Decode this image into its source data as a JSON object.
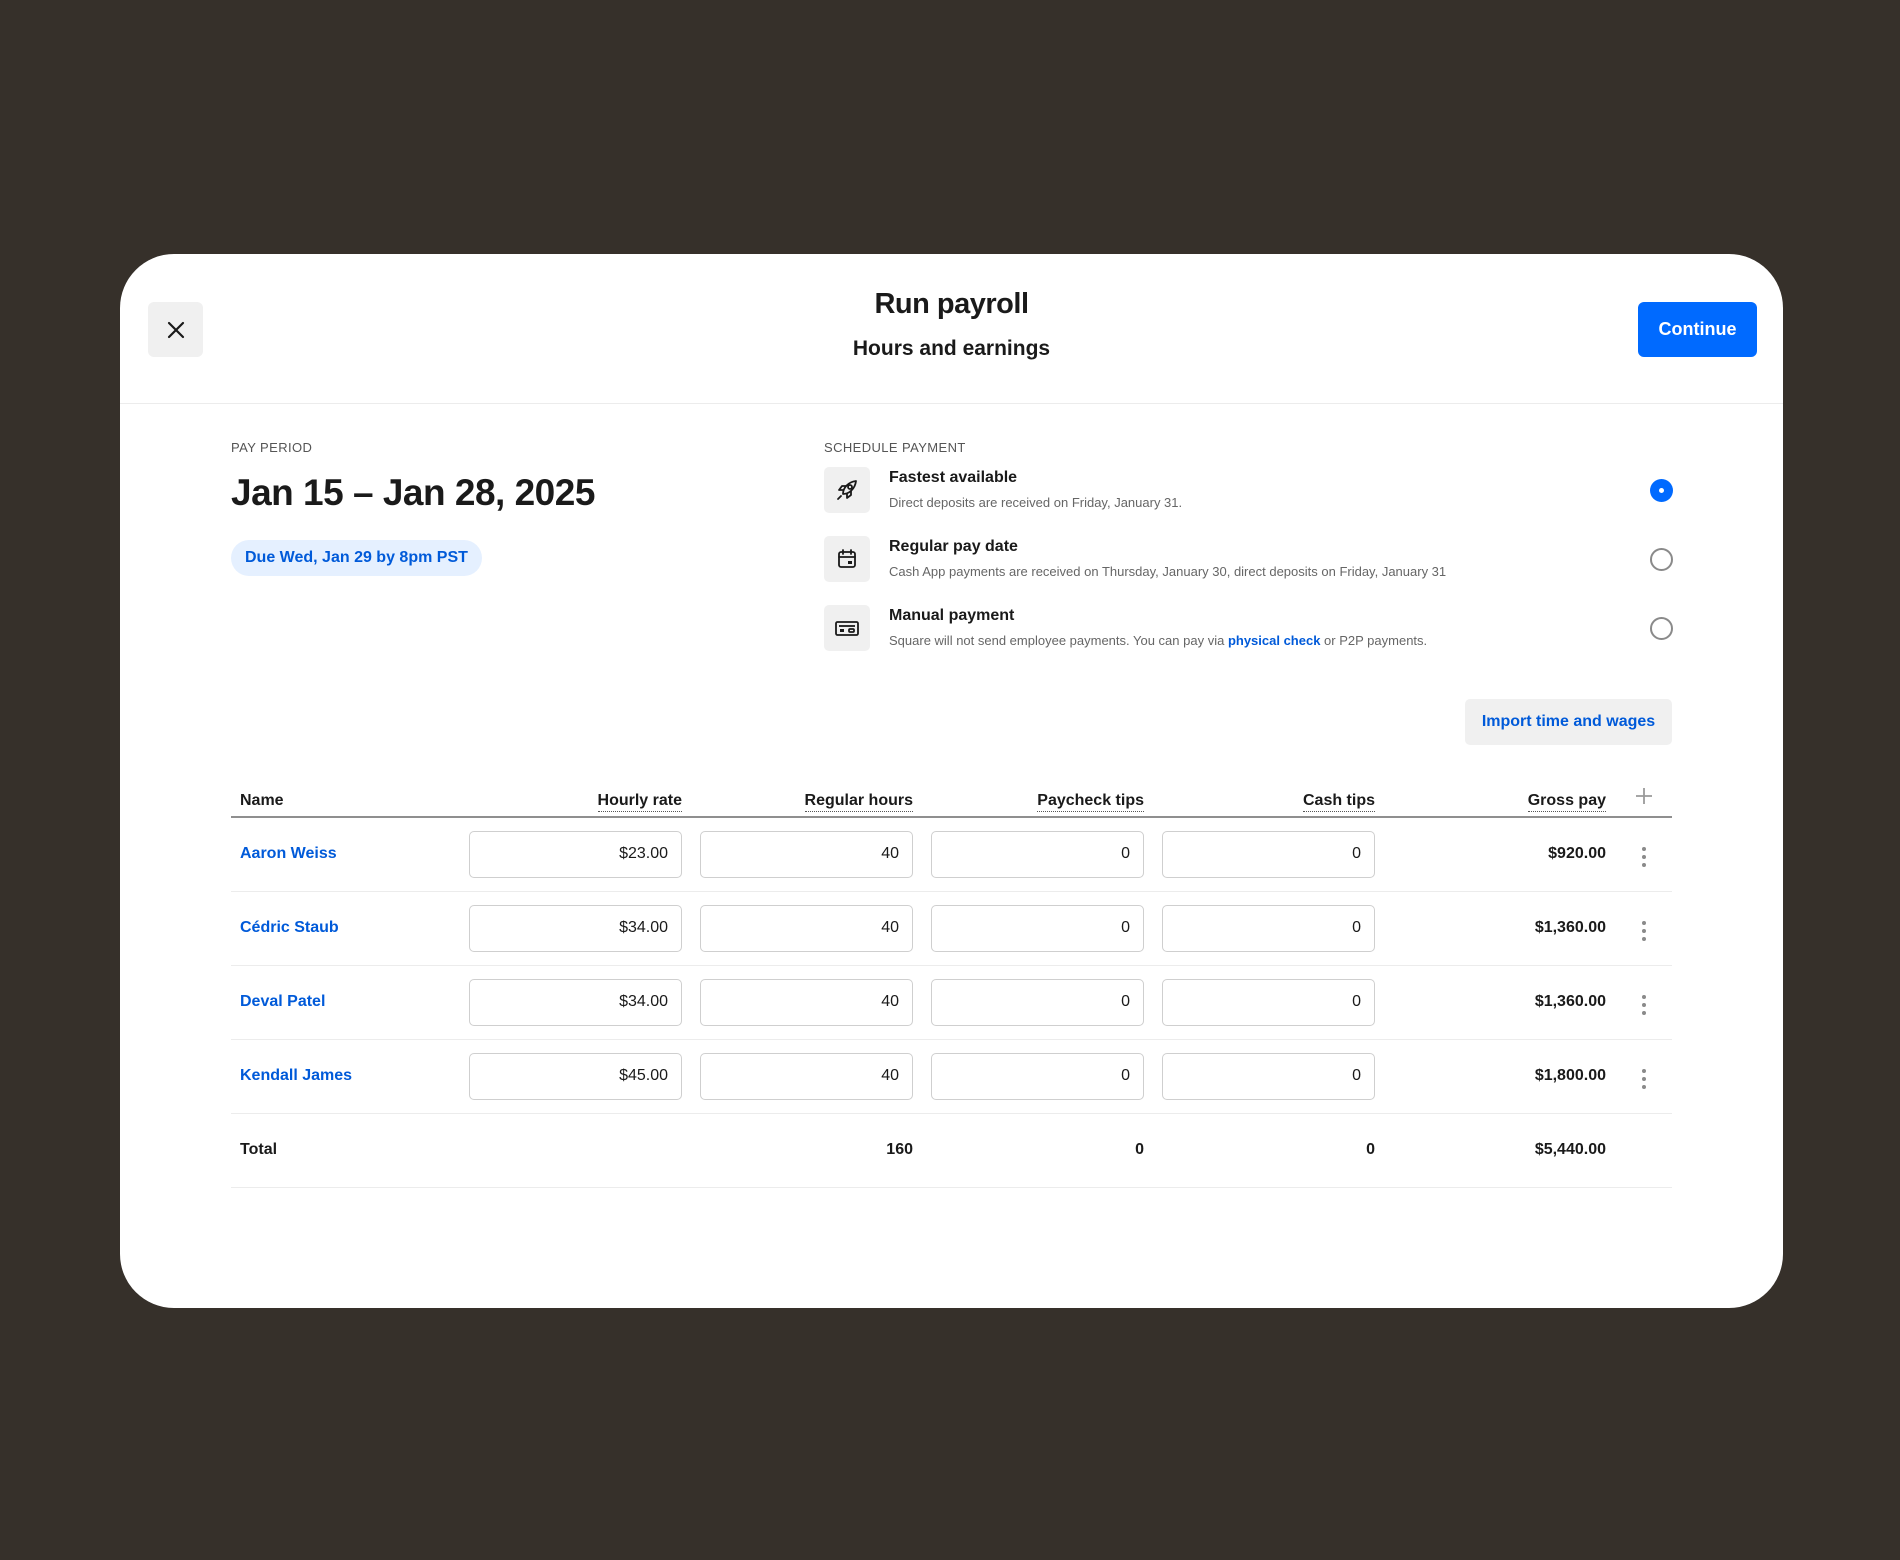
{
  "header": {
    "title": "Run payroll",
    "subtitle": "Hours and earnings",
    "continue_label": "Continue"
  },
  "pay_period": {
    "label": "PAY PERIOD",
    "range": "Jan 15 – Jan 28, 2025",
    "due": "Due Wed, Jan 29 by 8pm PST"
  },
  "schedule": {
    "label": "SCHEDULE PAYMENT",
    "options": [
      {
        "icon": "rocket-icon",
        "title": "Fastest available",
        "desc": "Direct deposits are received on Friday, January 31.",
        "selected": true
      },
      {
        "icon": "calendar-icon",
        "title": "Regular pay date",
        "desc": "Cash App payments are received on Thursday, January 30, direct deposits on Friday, January 31",
        "selected": false
      },
      {
        "icon": "check-icon",
        "title": "Manual payment",
        "desc_before": "Square will not send employee payments. You can pay via ",
        "desc_link": "physical check",
        "desc_after": " or P2P payments.",
        "selected": false
      }
    ]
  },
  "import_label": "Import time and wages",
  "table": {
    "columns": {
      "name": "Name",
      "rate": "Hourly rate",
      "hours": "Regular hours",
      "paycheck_tips": "Paycheck tips",
      "cash_tips": "Cash tips",
      "gross": "Gross pay"
    },
    "rows": [
      {
        "name": "Aaron Weiss",
        "rate": "$23.00",
        "hours": "40",
        "paycheck_tips": "0",
        "cash_tips": "0",
        "gross": "$920.00"
      },
      {
        "name": "Cédric Staub",
        "rate": "$34.00",
        "hours": "40",
        "paycheck_tips": "0",
        "cash_tips": "0",
        "gross": "$1,360.00"
      },
      {
        "name": "Deval Patel",
        "rate": "$34.00",
        "hours": "40",
        "paycheck_tips": "0",
        "cash_tips": "0",
        "gross": "$1,360.00"
      },
      {
        "name": "Kendall James",
        "rate": "$45.00",
        "hours": "40",
        "paycheck_tips": "0",
        "cash_tips": "0",
        "gross": "$1,800.00"
      }
    ],
    "total": {
      "label": "Total",
      "hours": "160",
      "paycheck_tips": "0",
      "cash_tips": "0",
      "gross": "$5,440.00"
    }
  },
  "colors": {
    "backdrop": "#36302a",
    "accent": "#006aff",
    "link": "#005ad9",
    "badge_bg": "#e5f0ff"
  }
}
